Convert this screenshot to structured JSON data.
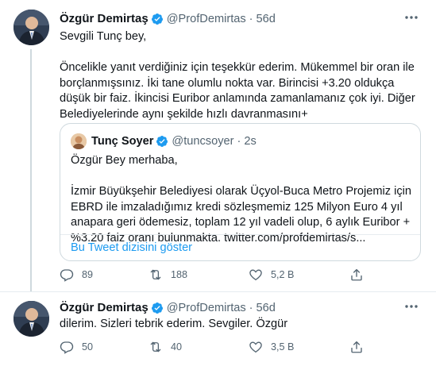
{
  "tweets": [
    {
      "author_name": "Özgür Demirtaş",
      "handle": "@ProfDemirtas",
      "separator": "·",
      "time": "56d",
      "paragraphs": [
        "Sevgili Tunç bey,",
        "Öncelikle yanıt verdiğiniz için teşekkür ederim. Mükemmel bir oran ile borçlanmışsınız. İki tane olumlu nokta var. Birincisi +3.20 oldukça düşük bir faiz. İkincisi Euribor anlamında zamanlamanız çok iyi. Diğer Belediyelerinde aynı şekilde hızlı davranmasını+"
      ],
      "quote": {
        "author_name": "Tunç Soyer",
        "handle": "@tuncsoyer",
        "separator": "·",
        "time": "2s",
        "paragraphs": [
          "Özgür Bey merhaba,",
          "İzmir Büyükşehir Belediyesi olarak Üçyol-Buca Metro Projemiz için EBRD ile imzaladığımız kredi sözleşmemiz 125 Milyon Euro 4 yıl anapara geri ödemesiz, toplam 12 yıl vadeli olup, 6 aylık Euribor + %3.20 faiz oranı bulunmakta. twitter.com/profdemirtas/s..."
        ],
        "show_thread": "Bu Tweet dizisini göster"
      },
      "stats": {
        "replies": "89",
        "retweets": "188",
        "likes": "5,2 B"
      }
    },
    {
      "author_name": "Özgür Demirtaş",
      "handle": "@ProfDemirtas",
      "separator": "·",
      "time": "56d",
      "paragraphs": [
        "dilerim. Sizleri tebrik ederim. Sevgiler. Özgür"
      ],
      "stats": {
        "replies": "50",
        "retweets": "40",
        "likes": "3,5 B"
      }
    }
  ],
  "icons": {
    "verified": "verified-badge-icon",
    "more": "more-options-icon",
    "reply": "reply-icon",
    "retweet": "retweet-icon",
    "like": "heart-icon",
    "share": "share-icon"
  },
  "colors": {
    "accent": "#1d9bf0",
    "secondary_text": "#536471",
    "border": "#cfd9de"
  }
}
